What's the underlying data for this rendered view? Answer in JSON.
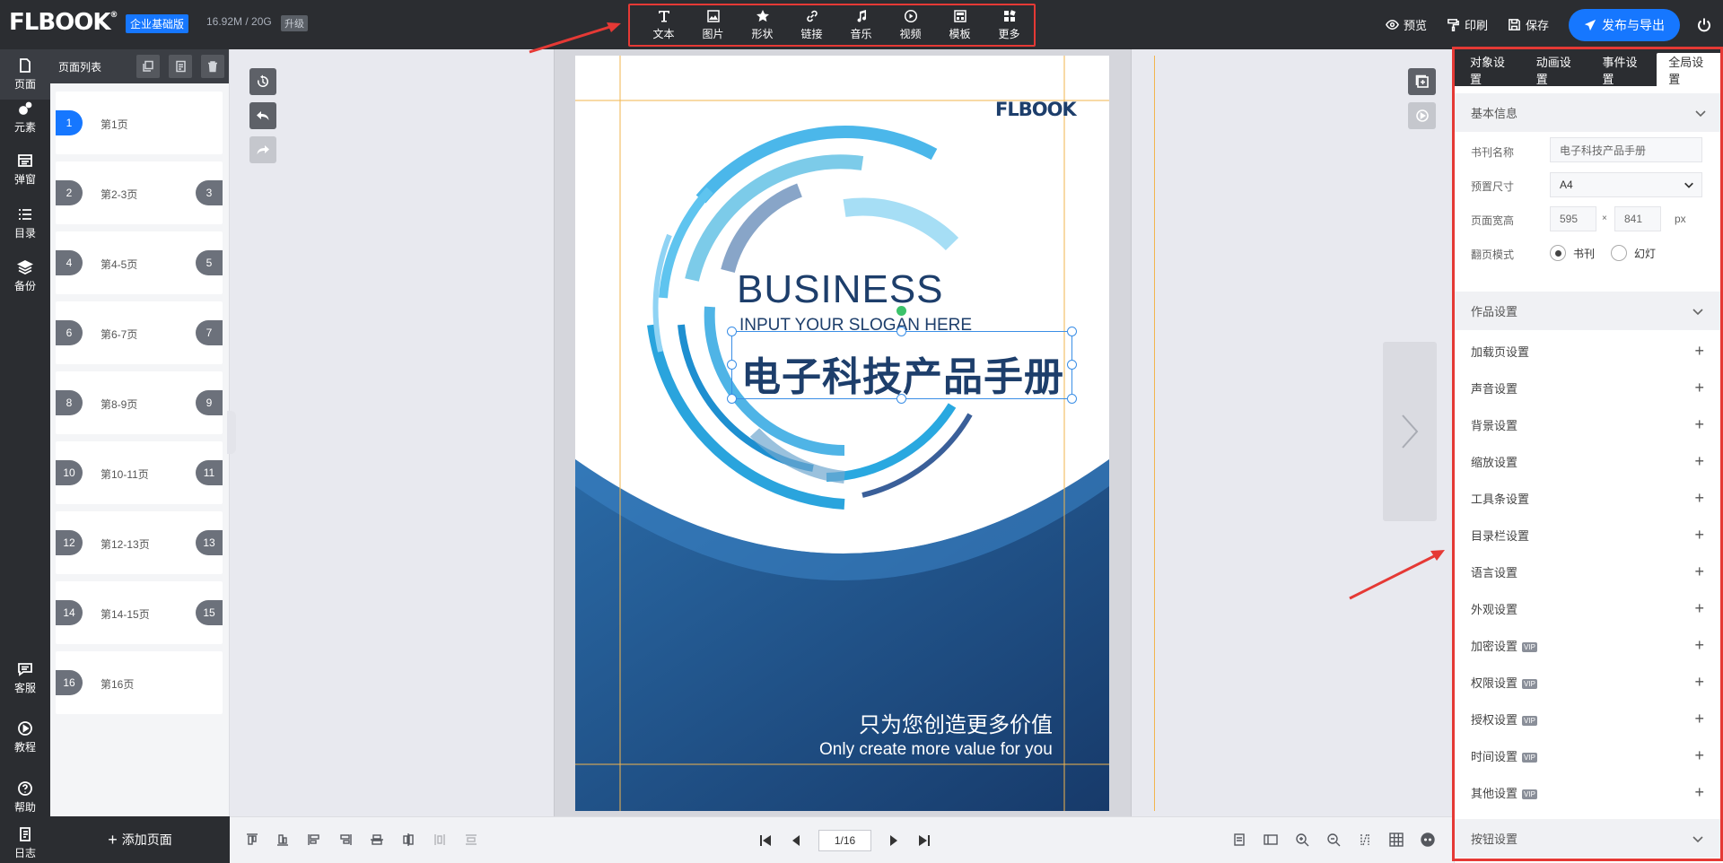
{
  "topbar": {
    "logo": "FLBOOK",
    "edition": "企业基础版",
    "storage": "16.92M / 20G",
    "upgrade": "升级",
    "tools": [
      {
        "label": "文本",
        "icon": "text-icon"
      },
      {
        "label": "图片",
        "icon": "image-icon"
      },
      {
        "label": "形状",
        "icon": "star-icon"
      },
      {
        "label": "链接",
        "icon": "link-icon"
      },
      {
        "label": "音乐",
        "icon": "music-icon"
      },
      {
        "label": "视频",
        "icon": "video-icon"
      },
      {
        "label": "模板",
        "icon": "template-icon"
      },
      {
        "label": "更多",
        "icon": "more-icon"
      }
    ],
    "preview": "预览",
    "print": "印刷",
    "save": "保存",
    "publish": "发布与导出"
  },
  "leftnav": {
    "items": [
      {
        "label": "页面"
      },
      {
        "label": "元素"
      },
      {
        "label": "弹窗"
      },
      {
        "label": "目录"
      },
      {
        "label": "备份"
      },
      {
        "label": "客服"
      },
      {
        "label": "教程"
      },
      {
        "label": "帮助"
      },
      {
        "label": "日志"
      }
    ]
  },
  "pagelist": {
    "title": "页面列表",
    "pages": [
      {
        "left": "1",
        "label": "第1页",
        "right": ""
      },
      {
        "left": "2",
        "label": "第2-3页",
        "right": "3"
      },
      {
        "left": "4",
        "label": "第4-5页",
        "right": "5"
      },
      {
        "left": "6",
        "label": "第6-7页",
        "right": "7"
      },
      {
        "left": "8",
        "label": "第8-9页",
        "right": "9"
      },
      {
        "left": "10",
        "label": "第10-11页",
        "right": "11"
      },
      {
        "left": "12",
        "label": "第12-13页",
        "right": "13"
      },
      {
        "left": "14",
        "label": "第14-15页",
        "right": "15"
      },
      {
        "left": "16",
        "label": "第16页",
        "right": ""
      }
    ],
    "add": "添加页面"
  },
  "canvas": {
    "brand": "FLBOOK",
    "headline": "BUSINESS",
    "slogan": "INPUT YOUR SLOGAN HERE",
    "title": "电子科技产品手册",
    "tagline_cn": "只为您创造更多价值",
    "tagline_en": "Only create more value for you",
    "colors": {
      "navy": "#1d3e6b",
      "cyan": "#29a8e0",
      "light_blue": "#8fd3f4"
    }
  },
  "pager": {
    "value": "1/16"
  },
  "settings": {
    "tabs": [
      "对象设置",
      "动画设置",
      "事件设置",
      "全局设置"
    ],
    "basic": {
      "title": "基本信息",
      "book_name_label": "书刊名称",
      "book_name": "电子科技产品手册",
      "preset_label": "预置尺寸",
      "preset": "A4",
      "size_label": "页面宽高",
      "width": "595",
      "times": "×",
      "height": "841",
      "unit": "px",
      "flip_label": "翻页模式",
      "flip_book": "书刊",
      "flip_slide": "幻灯"
    },
    "work": {
      "title": "作品设置",
      "items": [
        {
          "label": "加载页设置",
          "vip": ""
        },
        {
          "label": "声音设置",
          "vip": ""
        },
        {
          "label": "背景设置",
          "vip": ""
        },
        {
          "label": "缩放设置",
          "vip": ""
        },
        {
          "label": "工具条设置",
          "vip": ""
        },
        {
          "label": "目录栏设置",
          "vip": ""
        },
        {
          "label": "语言设置",
          "vip": ""
        },
        {
          "label": "外观设置",
          "vip": ""
        },
        {
          "label": "加密设置",
          "vip": "VIP"
        },
        {
          "label": "权限设置",
          "vip": "VIP"
        },
        {
          "label": "授权设置",
          "vip": "VIP"
        },
        {
          "label": "时间设置",
          "vip": "VIP"
        },
        {
          "label": "其他设置",
          "vip": "VIP"
        }
      ]
    },
    "button_section": "按钮设置"
  }
}
